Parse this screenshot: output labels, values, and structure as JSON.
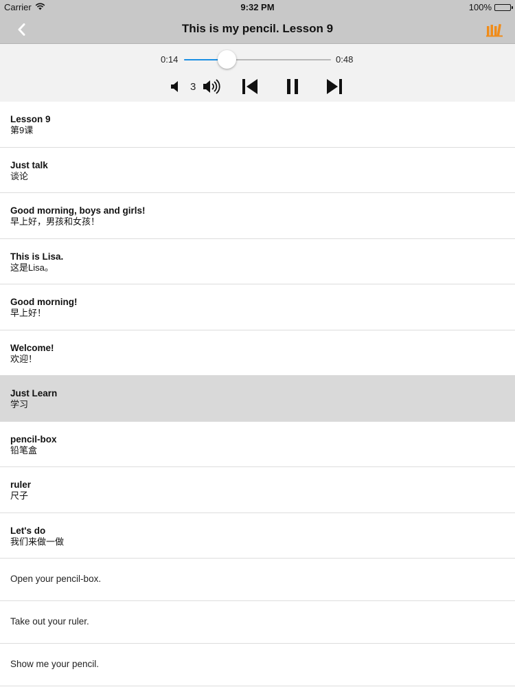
{
  "status": {
    "carrier": "Carrier",
    "time": "9:32 PM",
    "battery": "100%",
    "battery_level": 1.0
  },
  "nav": {
    "title": "This is my pencil. Lesson 9",
    "accent": "#f08c1a"
  },
  "player": {
    "elapsed": "0:14",
    "duration": "0:48",
    "progress": 0.29,
    "volume": "3",
    "accent": "#1a8fe3"
  },
  "list": [
    {
      "title": "Lesson 9",
      "subtitle": "第9课"
    },
    {
      "title": "Just talk",
      "subtitle": "谈论"
    },
    {
      "title": "Good morning, boys and girls!",
      "subtitle": "早上好，男孩和女孩！"
    },
    {
      "title": "This is Lisa.",
      "subtitle": "这是Lisa。"
    },
    {
      "title": "Good morning!",
      "subtitle": "早上好！"
    },
    {
      "title": "Welcome!",
      "subtitle": "欢迎！"
    },
    {
      "title": "Just Learn",
      "subtitle": "学习"
    },
    {
      "title": "pencil-box",
      "subtitle": "铅笔盒"
    },
    {
      "title": "ruler",
      "subtitle": "尺子"
    },
    {
      "title": "Let's do",
      "subtitle": "我们来做一做"
    },
    {
      "text": "Open your pencil-box."
    },
    {
      "text": "Take out your ruler."
    },
    {
      "text": "Show me your pencil."
    }
  ]
}
